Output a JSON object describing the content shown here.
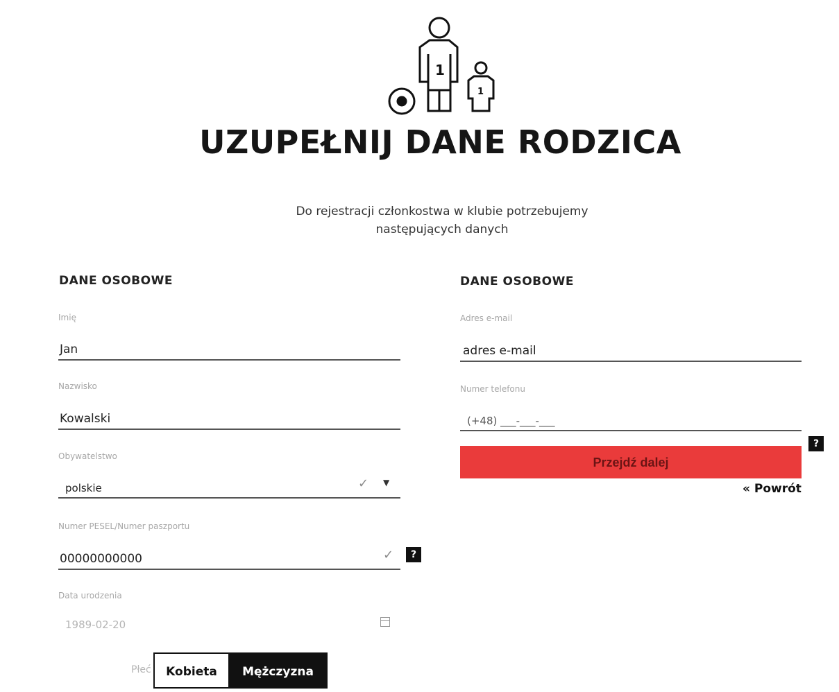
{
  "header": {
    "title": "UZUPEŁNIJ DANE RODZICA",
    "subtitle": "Do rejestracji członkostwa w klubie potrzebujemy następujących danych"
  },
  "left_section": {
    "heading": "DANE OSOBOWE",
    "first_name_label": "Imię",
    "first_name_value": "Jan",
    "last_name_label": "Nazwisko",
    "last_name_value": "Kowalski",
    "citizenship_label": "Obywatelstwo",
    "citizenship_value": "polskie",
    "pesel_label": "Numer PESEL/Numer paszportu",
    "pesel_value": "00000000000",
    "birthdate_label": "Data urodzenia",
    "birthdate_value": "1989-02-20",
    "gender_label": "Płeć",
    "gender_options": [
      "Kobieta",
      "Mężczyzna"
    ],
    "gender_selected": "Mężczyzna"
  },
  "right_section": {
    "heading": "DANE OSOBOWE",
    "email_label": "Adres e-mail",
    "email_value": "adres e-mail",
    "phone_label": "Numer telefonu",
    "phone_value": "(+48) ___-___-___",
    "next_button": "Przejdź dalej",
    "back_link": "« Powrót"
  },
  "help_glyph": "?",
  "colors": {
    "accent": "#ea3b3b",
    "dark": "#111111"
  }
}
